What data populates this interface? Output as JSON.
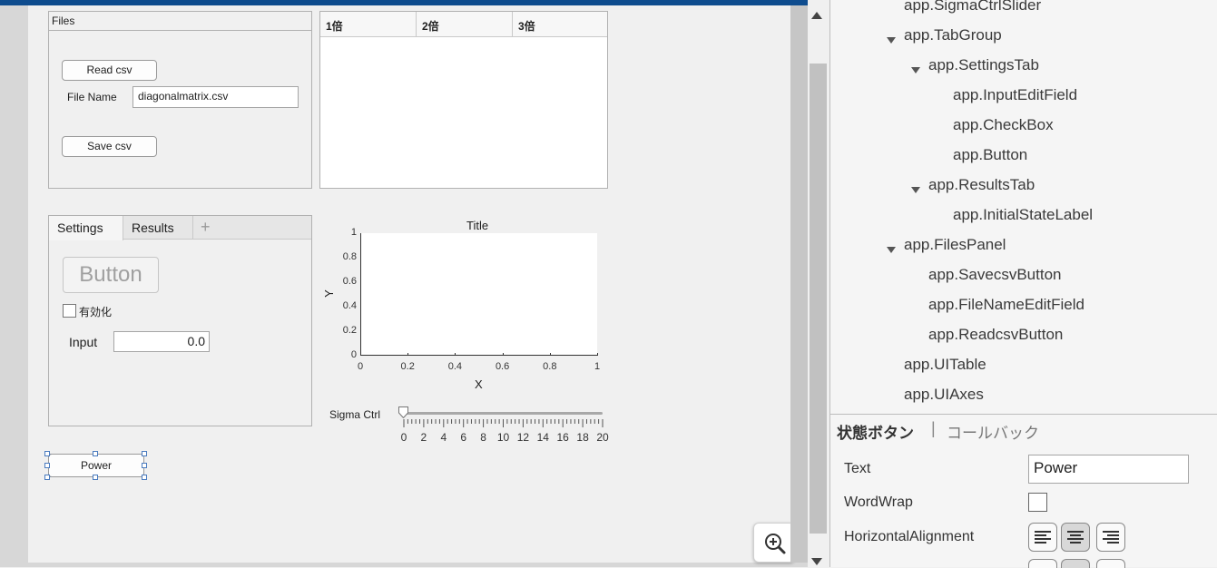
{
  "files_panel": {
    "title": "Files",
    "read_button": "Read csv",
    "file_name_label": "File Name",
    "file_name_value": "diagonalmatrix.csv",
    "save_button": "Save csv"
  },
  "table": {
    "columns": [
      "1倍",
      "2倍",
      "3倍"
    ]
  },
  "tab_group": {
    "tabs": [
      "Settings",
      "Results"
    ],
    "add_symbol": "+",
    "button_label": "Button",
    "checkbox_label": "有効化",
    "input_label": "Input",
    "input_value": "0.0"
  },
  "axes": {
    "title": "Title",
    "xlabel": "X",
    "ylabel": "Y",
    "xticks": [
      "0",
      "0.2",
      "0.4",
      "0.6",
      "0.8",
      "1"
    ],
    "yticks": [
      "0",
      "0.2",
      "0.4",
      "0.6",
      "0.8",
      "1"
    ]
  },
  "slider": {
    "label": "Sigma Ctrl",
    "ticks": [
      "0",
      "2",
      "4",
      "6",
      "8",
      "10",
      "12",
      "14",
      "16",
      "18",
      "20"
    ],
    "value": 0
  },
  "power_button": {
    "label": "Power"
  },
  "component_tree": [
    {
      "label": "app.SigmaCtrlSlider",
      "indent": 0,
      "expanded": null
    },
    {
      "label": "app.TabGroup",
      "indent": 0,
      "expanded": true
    },
    {
      "label": "app.SettingsTab",
      "indent": 1,
      "expanded": true
    },
    {
      "label": "app.InputEditField",
      "indent": 2,
      "expanded": null
    },
    {
      "label": "app.CheckBox",
      "indent": 2,
      "expanded": null
    },
    {
      "label": "app.Button",
      "indent": 2,
      "expanded": null
    },
    {
      "label": "app.ResultsTab",
      "indent": 1,
      "expanded": true
    },
    {
      "label": "app.InitialStateLabel",
      "indent": 2,
      "expanded": null
    },
    {
      "label": "app.FilesPanel",
      "indent": 0,
      "expanded": true
    },
    {
      "label": "app.SavecsvButton",
      "indent": 1,
      "expanded": null
    },
    {
      "label": "app.FileNameEditField",
      "indent": 1,
      "expanded": null
    },
    {
      "label": "app.ReadcsvButton",
      "indent": 1,
      "expanded": null
    },
    {
      "label": "app.UITable",
      "indent": 0,
      "expanded": null
    },
    {
      "label": "app.UIAxes",
      "indent": 0,
      "expanded": null
    }
  ],
  "inspector": {
    "tab_active": "状態ボタン",
    "tab_separator": "|",
    "tab_inactive": "コールバック",
    "text_label": "Text",
    "text_value": "Power",
    "wordwrap_label": "WordWrap",
    "halign_label": "HorizontalAlignment"
  },
  "icons": {
    "zoom": "zoom-in-icon",
    "scroll_up": "scroll-up-arrow-icon",
    "scroll_down": "scroll-down-arrow-icon"
  },
  "colors": {
    "accent_bar": "#0e4c8e",
    "selection": "#4a7bbf"
  }
}
